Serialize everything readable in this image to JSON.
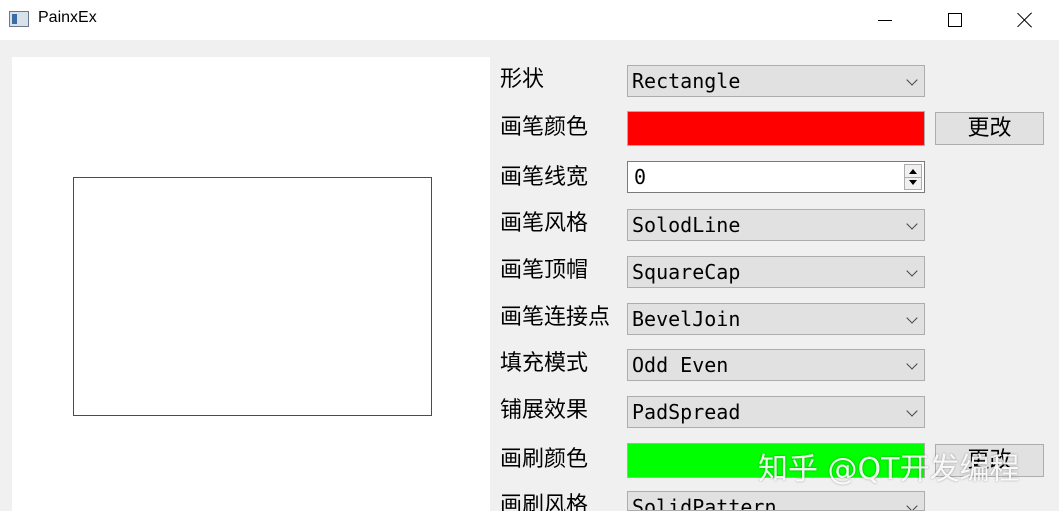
{
  "window": {
    "title": "PainxEx",
    "icon": "app-window-icon"
  },
  "colors": {
    "pen_color": "#ff0000",
    "brush_color": "#00ff00",
    "shape_stroke": "#ff0000"
  },
  "controls": {
    "shape": {
      "label": "形状",
      "value": "Rectangle"
    },
    "pen_color": {
      "label": "画笔颜色",
      "button": "更改"
    },
    "pen_width": {
      "label": "画笔线宽",
      "value": "0"
    },
    "pen_style": {
      "label": "画笔风格",
      "value": "SolodLine"
    },
    "pen_cap": {
      "label": "画笔顶帽",
      "value": "SquareCap"
    },
    "pen_join": {
      "label": "画笔连接点",
      "value": "BevelJoin"
    },
    "fill_mode": {
      "label": "填充模式",
      "value": "Odd Even"
    },
    "spread": {
      "label": "铺展效果",
      "value": "PadSpread"
    },
    "brush_color": {
      "label": "画刷颜色",
      "button": "更改"
    },
    "brush_style": {
      "label": "画刷风格",
      "value": "SolidPattern"
    }
  },
  "watermark": "知乎 @QT开发编程"
}
